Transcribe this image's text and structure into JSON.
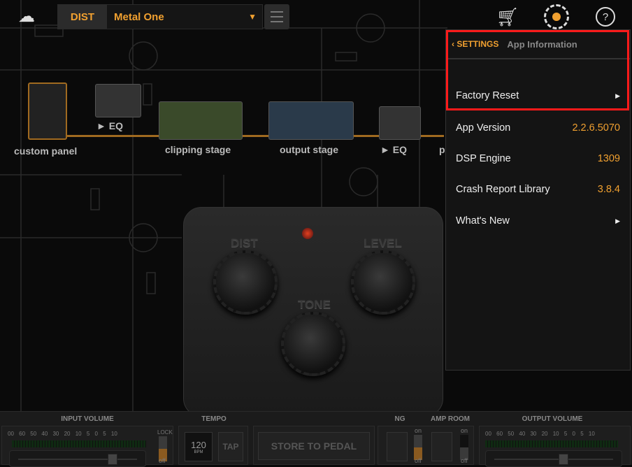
{
  "topbar": {
    "category": "DIST",
    "preset_name": "Metal One",
    "help": "?"
  },
  "chain": [
    {
      "label": "custom panel"
    },
    {
      "label": "► EQ"
    },
    {
      "label": "clipping stage"
    },
    {
      "label": "output stage"
    },
    {
      "label": "► EQ"
    },
    {
      "label": "p"
    }
  ],
  "pedal": {
    "knobs": [
      "DIST",
      "LEVEL",
      "TONE"
    ]
  },
  "settings": {
    "back_label": "SETTINGS",
    "title": "App Information",
    "rows": [
      {
        "label": "Factory Reset",
        "value": null
      },
      {
        "label": "App Version",
        "value": "2.2.6.5070"
      },
      {
        "label": "DSP Engine",
        "value": "1309"
      },
      {
        "label": "Crash Report Library",
        "value": "3.8.4"
      },
      {
        "label": "What's New",
        "value": null
      }
    ]
  },
  "bottom": {
    "input_volume": "INPUT VOLUME",
    "tempo": "TEMPO",
    "ng": "NG",
    "amp_room": "AMP ROOM",
    "output_volume": "OUTPUT VOLUME",
    "scale": "00 60 50 40 30 20 10 5 0 5 10",
    "lock": "LOCK",
    "off": "off",
    "on": "on",
    "bpm_value": "120",
    "bpm_unit": "BPM",
    "tap": "TAP",
    "store": "STORE TO PEDAL"
  },
  "colors": {
    "accent": "#f0a030",
    "highlight": "#ff1a1a"
  }
}
